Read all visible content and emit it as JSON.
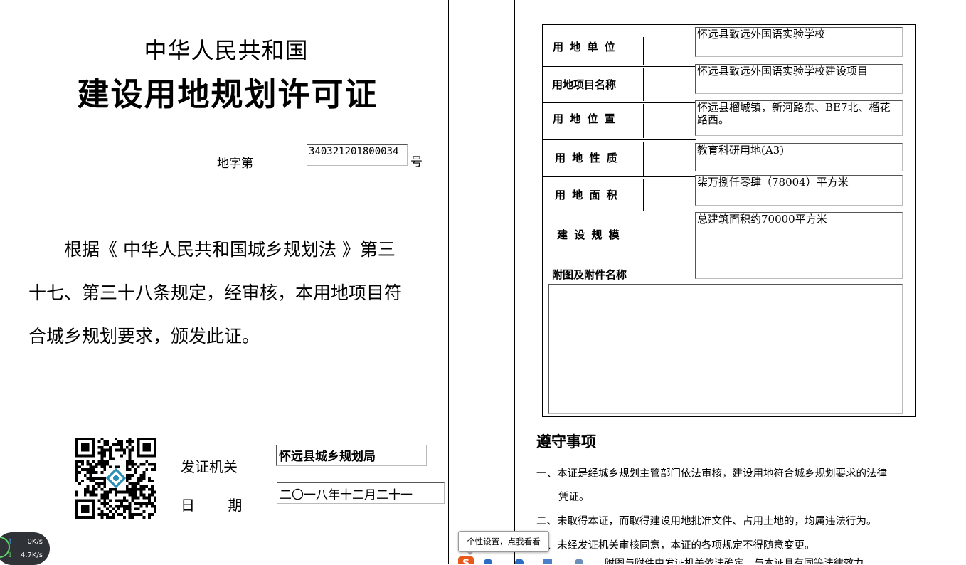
{
  "certificate": {
    "country": "中华人民共和国",
    "title": "建设用地规划许可证",
    "number_label": "地字第",
    "number": "340321201800034",
    "number_suffix": "号",
    "body_lines": [
      "根据《 中华人民共和国城乡规划法 》第三",
      "十七、第三十八条规定，经审核，本用地项目符",
      "合城乡规划要求，颁发此证。"
    ],
    "issuer_label": "发证机关",
    "issuer": "怀远县城乡规划局",
    "date_label": "日 期",
    "date": "二〇一八年十二月二十一"
  },
  "form": {
    "rows": [
      {
        "label": "用 地 单 位",
        "value": "怀远县致远外国语实验学校"
      },
      {
        "label": "用地项目名称",
        "value": "怀远县致远外国语实验学校建设项目"
      },
      {
        "label": "用 地 位 置",
        "value": "怀远县榴城镇，新河路东、BE7北、榴花路西。"
      },
      {
        "label": "用 地 性 质",
        "value": "教育科研用地(A3)"
      },
      {
        "label": "用 地 面 积",
        "value": "柒万捌仟零肆（78004）平方米"
      },
      {
        "label": "建 设 规 模",
        "value": "总建筑面积约70000平方米"
      }
    ],
    "attachment_label": "附图及附件名称",
    "attachment_value": ""
  },
  "notices": {
    "title": "遵守事项",
    "items": [
      "一、本证是经城乡规划主管部门依法审核，建设用地符合城乡规划要求的法律",
      "凭证。",
      "二、未取得本证，而取得建设用地批准文件、占用土地的，均属违法行为。",
      "三、未经发证机关审核同意，本证的各项规定不得随意变更。",
      "附图与附件由发证机关依法确定，与本证具有同等法律效力。"
    ]
  },
  "overlays": {
    "tooltip": "个性设置，点我看看",
    "net_up": "0K/s",
    "net_down": "4.7K/s",
    "ime_logo": "S"
  }
}
